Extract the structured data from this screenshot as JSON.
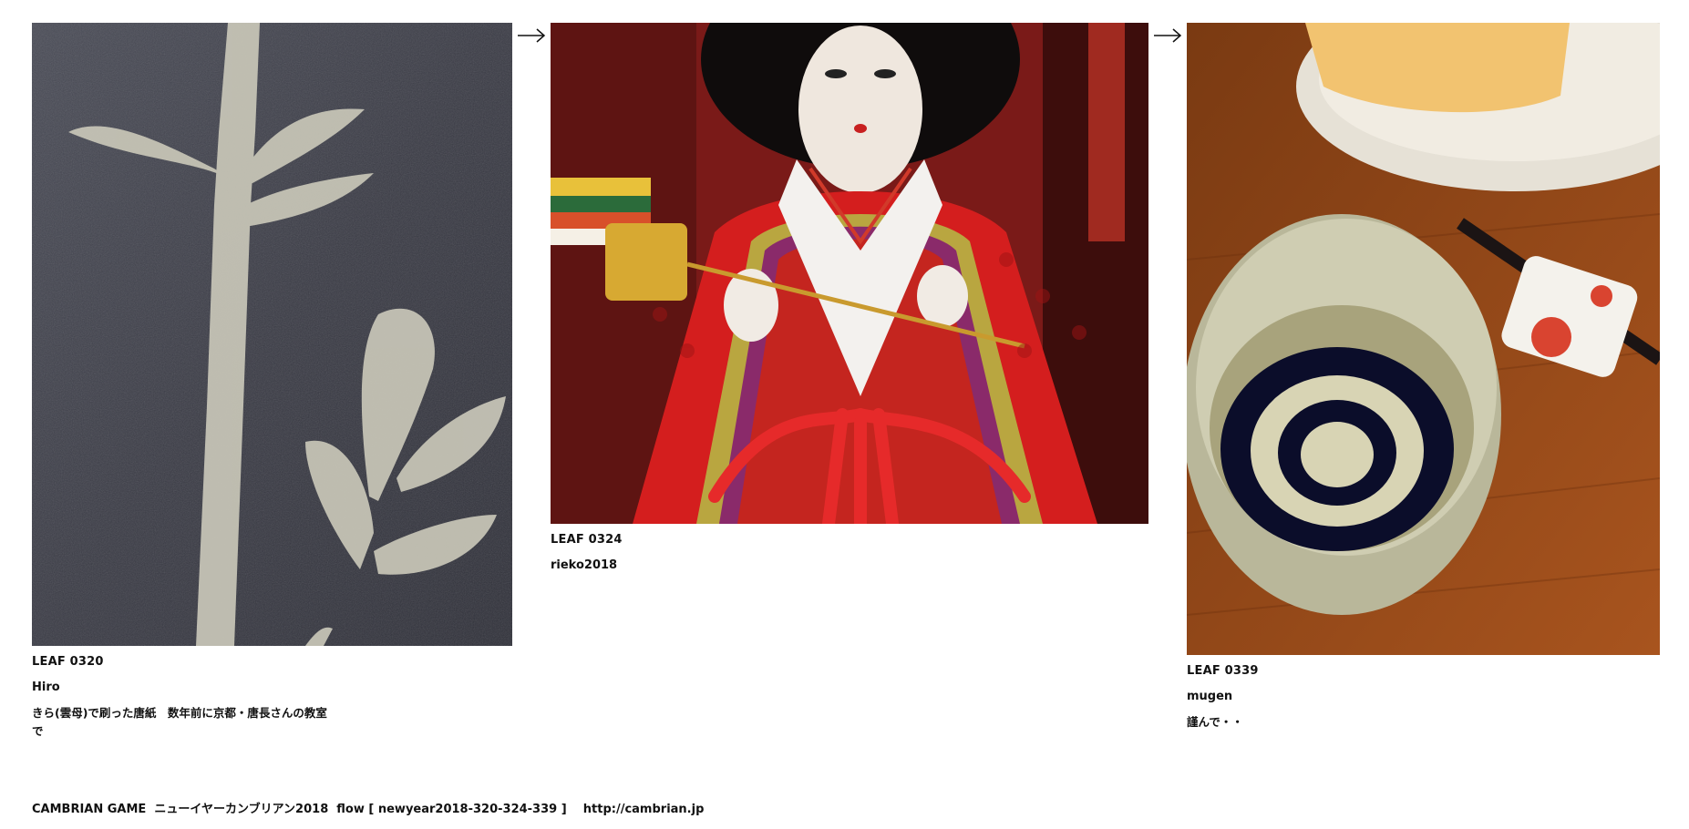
{
  "leaves": [
    {
      "id": "LEAF 0320",
      "author": "Hiro",
      "caption": "きら(雲母)で刷った唐紙　数年前に京都・唐長さんの教室で",
      "image_desc_icon": "karakami-print-image"
    },
    {
      "id": "LEAF 0324",
      "author": "rieko2018",
      "caption": "",
      "image_desc_icon": "hina-doll-image"
    },
    {
      "id": "LEAF 0339",
      "author": "mugen",
      "caption": "謹んで・・",
      "image_desc_icon": "sake-cup-image"
    }
  ],
  "arrows": [
    "arrow-right-icon",
    "arrow-right-icon"
  ],
  "footer": {
    "text": "CAMBRIAN GAME  ニューイヤーカンブリアン2018  flow [ newyear2018-320-324-339 ]    http://cambrian.jp"
  },
  "colors": {
    "background": "#ffffff",
    "text": "#111111"
  }
}
